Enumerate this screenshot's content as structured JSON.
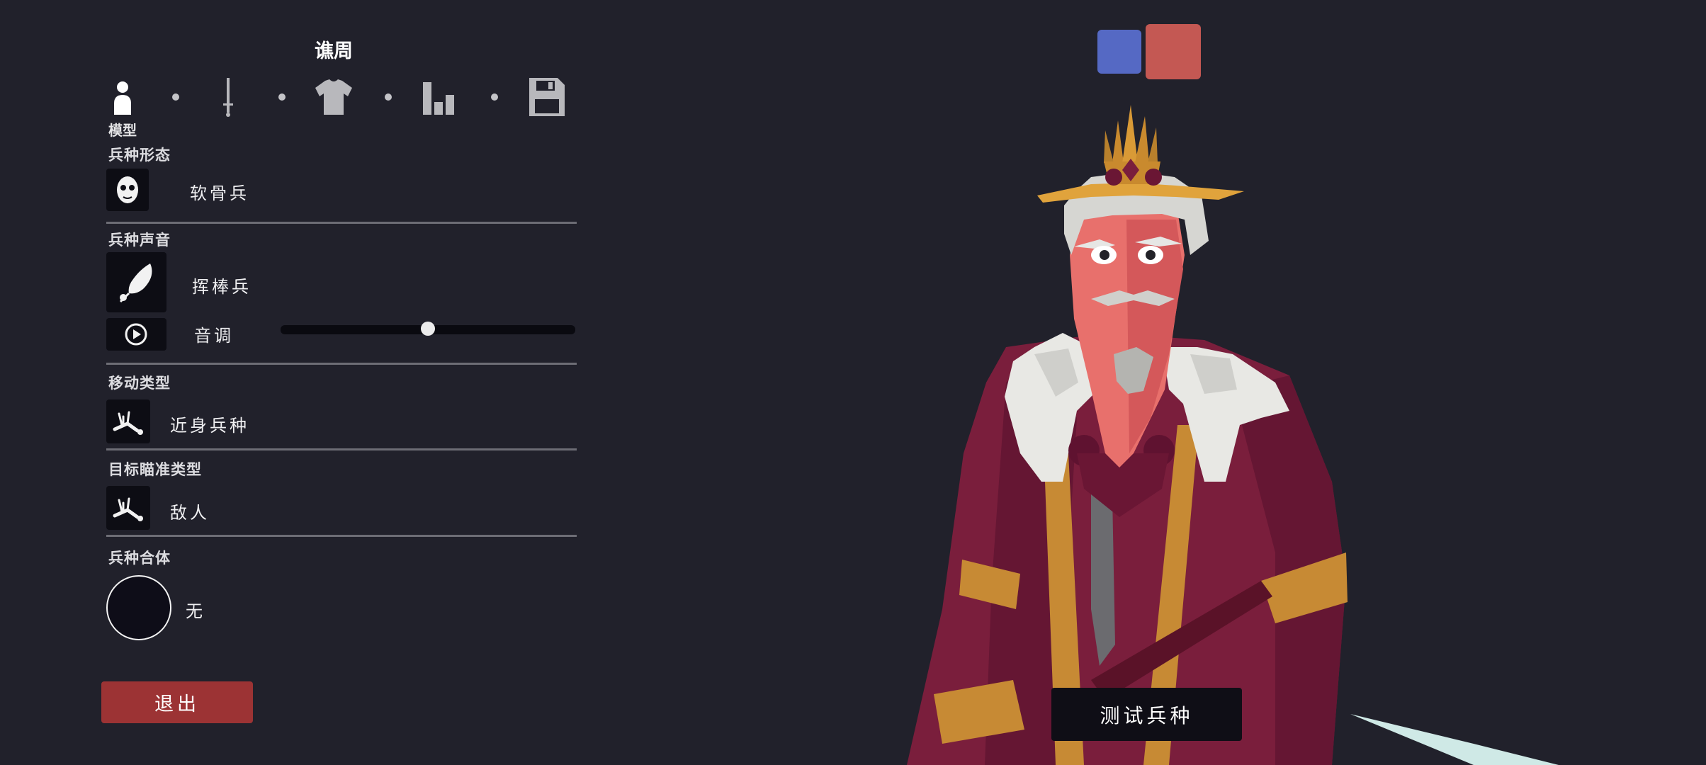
{
  "editor": {
    "title": "谯周",
    "tabs": [
      {
        "name": "model",
        "label": "模型",
        "active": true
      },
      {
        "name": "weapons",
        "active": false
      },
      {
        "name": "clothing",
        "active": false
      },
      {
        "name": "stats",
        "active": false
      },
      {
        "name": "save",
        "active": false
      }
    ]
  },
  "unit_body": {
    "label": "兵种形态",
    "value": "软骨兵",
    "icon": "skull-mask-icon"
  },
  "unit_voice": {
    "label": "兵种声音",
    "value": "挥棒兵",
    "icon": "feather-icon",
    "pitch_label": "音调",
    "pitch_value": 0.5
  },
  "movement": {
    "label": "移动类型",
    "value": "近身兵种",
    "icon": "fallen-unit-icon"
  },
  "targeting": {
    "label": "目标瞄准类型",
    "value": "敌人",
    "icon": "fallen-unit-icon"
  },
  "combine": {
    "label": "兵种合体",
    "value": "无"
  },
  "buttons": {
    "exit": "退出",
    "test": "测试兵种"
  },
  "team_colors": {
    "blue": "#5569c4",
    "red": "#c45853",
    "selected": "red"
  },
  "colors": {
    "background": "#21212b",
    "exit_button": "#9c3334",
    "robe": "#7a1e3c",
    "trim": "#c78a34",
    "skin": "#e8706c"
  }
}
